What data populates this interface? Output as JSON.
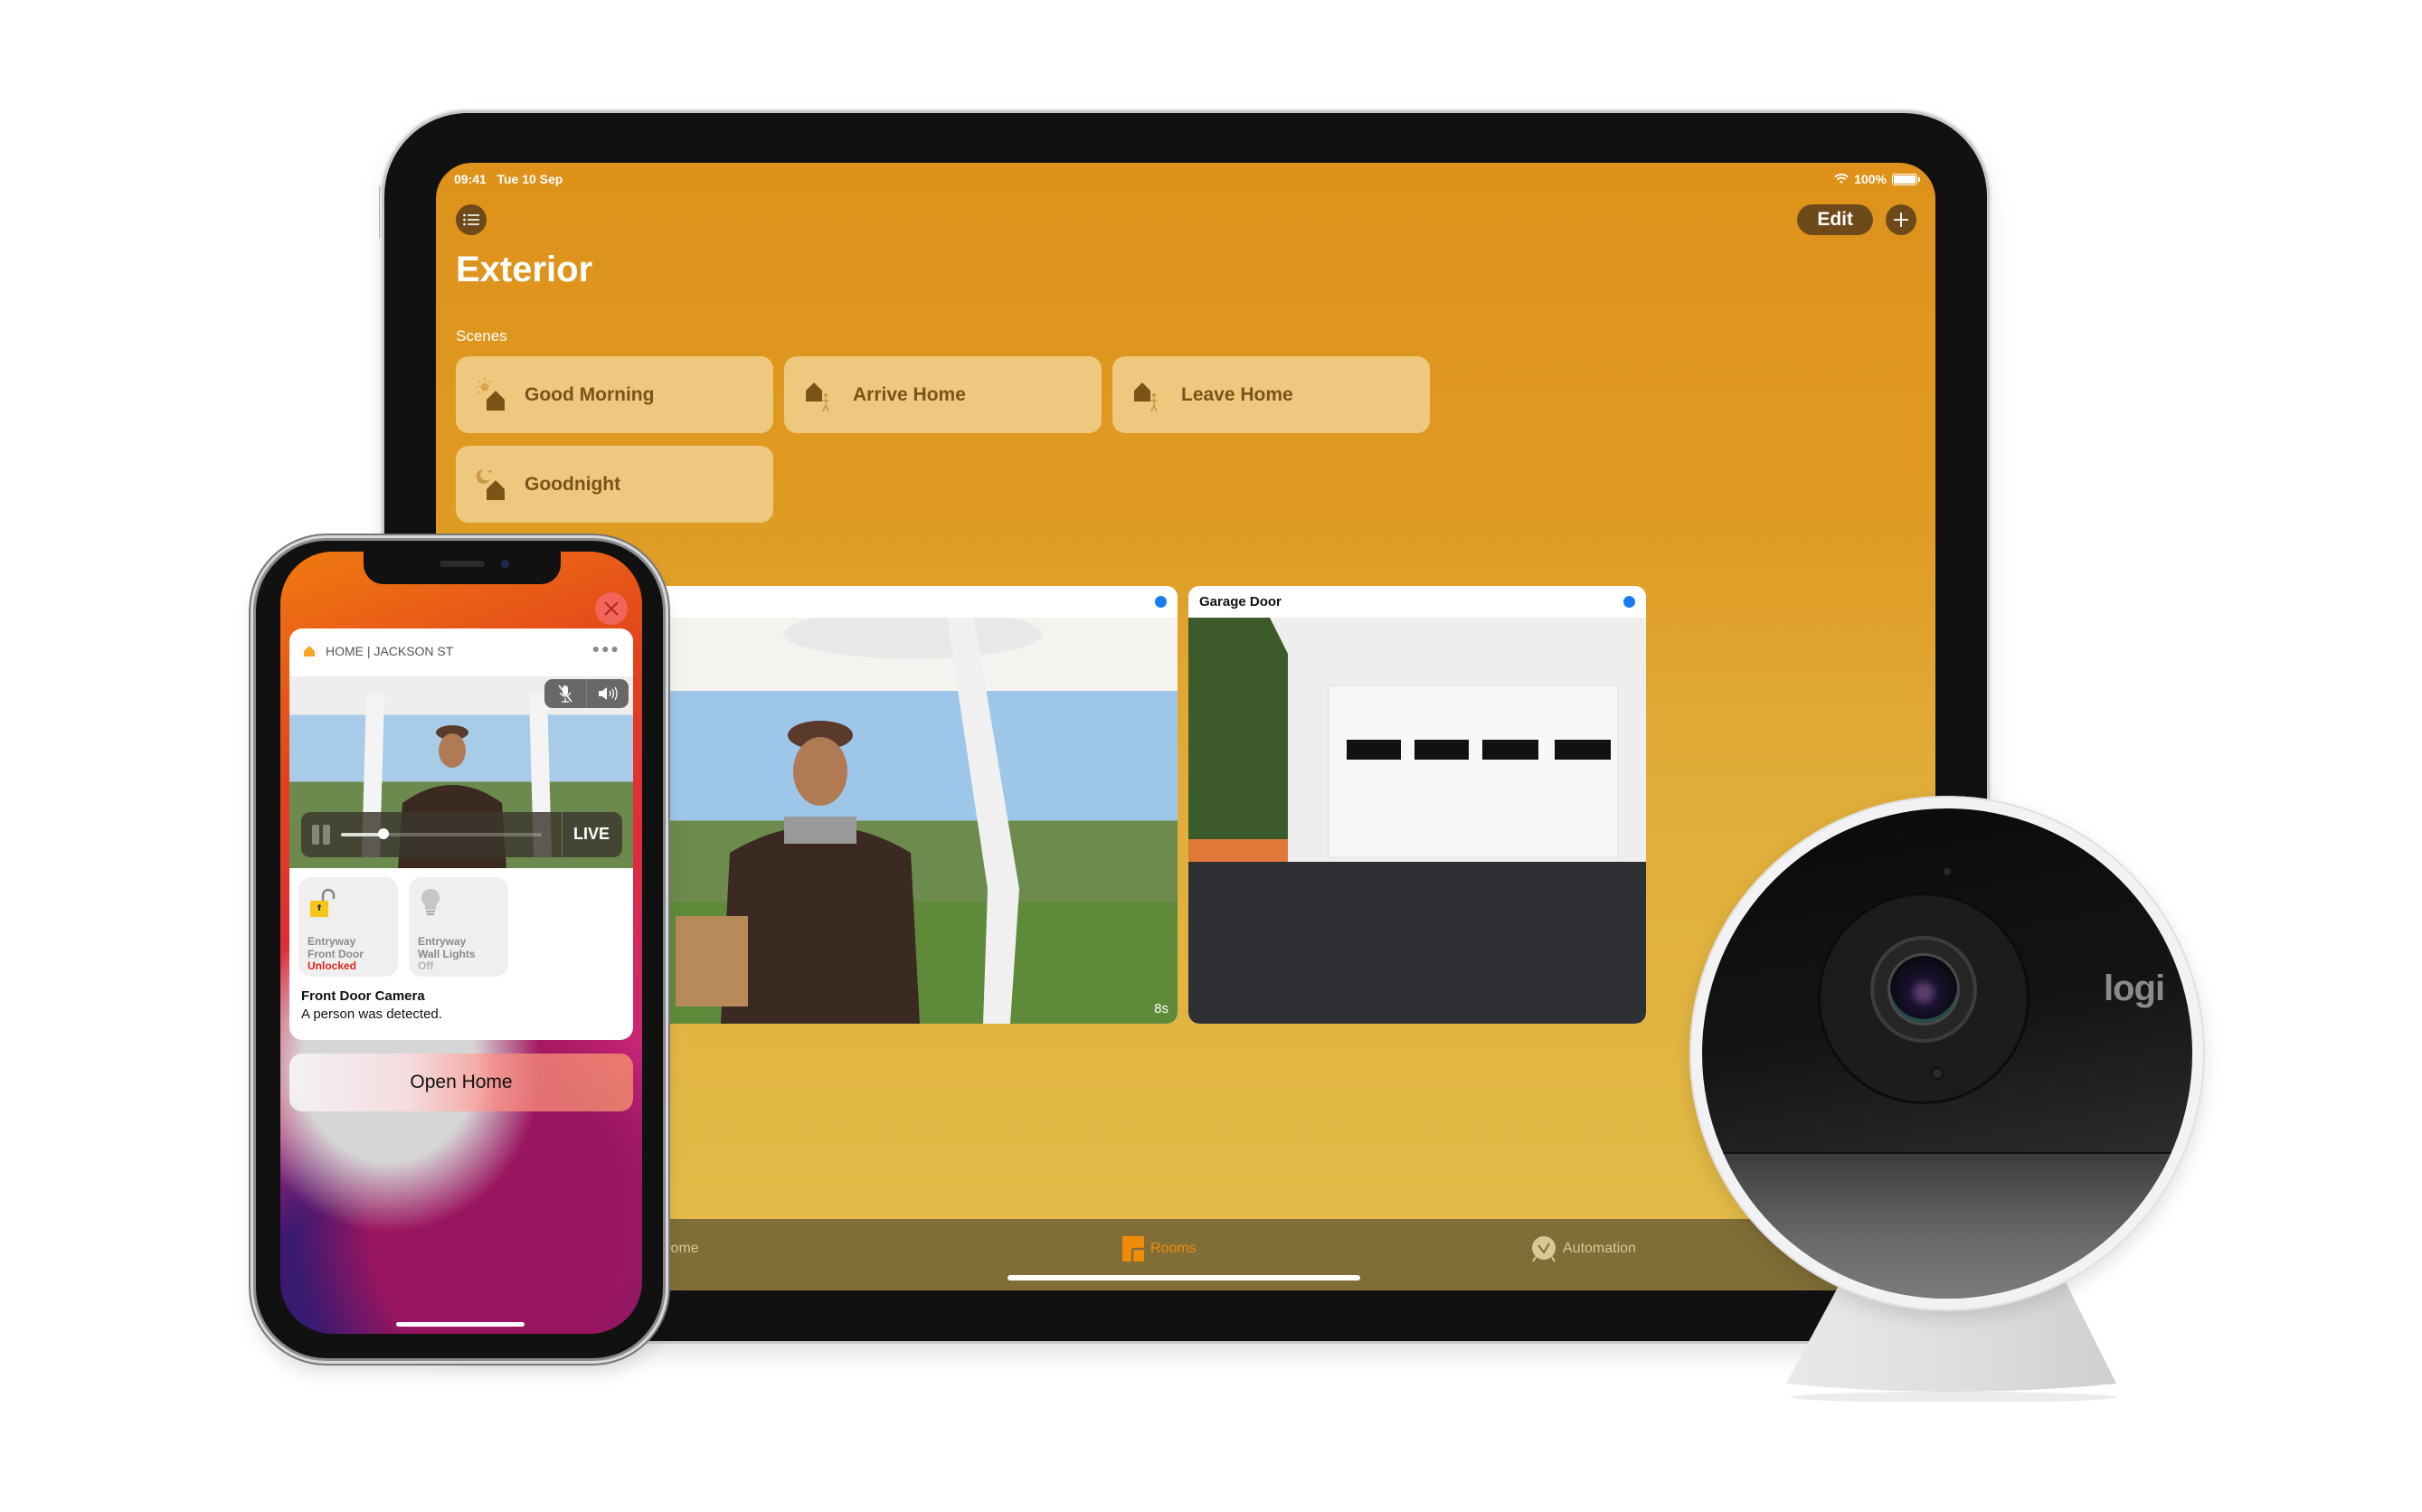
{
  "ipad": {
    "status_bar": {
      "time": "09:41",
      "date": "Tue 10 Sep",
      "battery": "100%",
      "battery_level": 1.0
    },
    "toolbar": {
      "menu_icon": "list-icon",
      "edit_label": "Edit",
      "add_icon": "plus-icon"
    },
    "page_title": "Exterior",
    "scenes": {
      "label": "Scenes",
      "items": [
        {
          "label": "Good Morning",
          "icon": "sun-house-icon"
        },
        {
          "label": "Arrive Home",
          "icon": "arrive-home-icon"
        },
        {
          "label": "Leave Home",
          "icon": "leave-home-icon"
        },
        {
          "label": "Goodnight",
          "icon": "moon-house-icon"
        }
      ]
    },
    "cameras": [
      {
        "title": "",
        "status_dot_color": "#1a7cf2",
        "timestamp": "8s"
      },
      {
        "title": "Garage Door",
        "status_dot_color": "#1a7cf2"
      }
    ],
    "tabbar": {
      "items": [
        {
          "label": "Home",
          "icon": "house-icon",
          "active": false
        },
        {
          "label": "Rooms",
          "icon": "rooms-icon",
          "active": true
        },
        {
          "label": "Automation",
          "icon": "clock-check-icon",
          "active": false
        }
      ]
    },
    "colors": {
      "accent": "#de921a",
      "scene_tile": "#eec87e",
      "scene_text": "#7a5417",
      "tabbar": "#806e36",
      "active_tab": "#f08c0a"
    }
  },
  "iphone": {
    "close_icon": "close-icon",
    "notification": {
      "app_name": "HOME | JACKSON ST",
      "more_icon": "ellipsis-icon",
      "player": {
        "live_label": "LIVE",
        "progress": 0.21,
        "mute_icon": "mic-muted-icon",
        "speaker_icon": "speaker-icon"
      },
      "accessories": [
        {
          "room": "Entryway",
          "name": "Front Door",
          "state": "Unlocked",
          "icon": "unlocked-padlock-icon"
        },
        {
          "room": "Entryway",
          "name": "Wall Lights",
          "state": "Off",
          "icon": "lightbulb-icon"
        }
      ],
      "title": "Front Door Camera",
      "body": "A person was detected."
    },
    "open_home_label": "Open Home"
  },
  "camera_device": {
    "brand": "logi"
  }
}
